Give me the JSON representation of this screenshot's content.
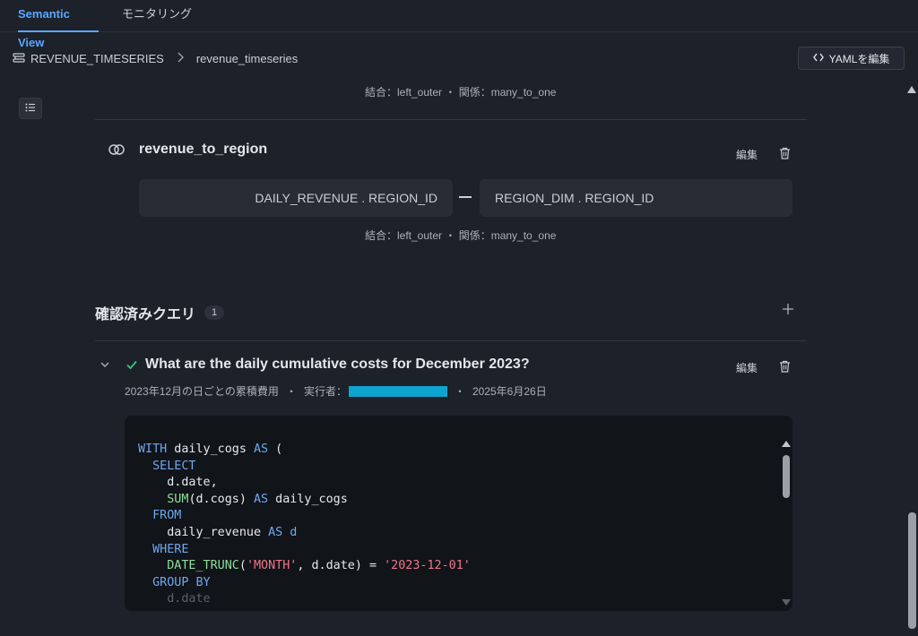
{
  "tabs": [
    {
      "label": "Semantic View",
      "active": true
    },
    {
      "label": "モニタリング",
      "active": false
    }
  ],
  "breadcrumb": {
    "model_name": "REVENUE_TIMESERIES",
    "separator_icon": "chevron-right-icon",
    "view_name": "revenue_timeseries"
  },
  "yaml_button": {
    "icon": "code-brackets-icon",
    "label": "YAMLを編集"
  },
  "outline_button": {
    "icon": "list-icon"
  },
  "relationship_prev": {
    "meta": "結合：left_outer ・ 関係：many_to_one"
  },
  "relationship": {
    "icon": "link-rings-icon",
    "name": "revenue_to_region",
    "edit_label": "編集",
    "left_field": "DAILY_REVENUE . REGION_ID",
    "right_field": "REGION_DIM . REGION_ID",
    "meta": "結合：left_outer ・ 関係：many_to_one"
  },
  "verified_queries": {
    "title": "確認済みクエリ",
    "count": "1",
    "add_icon": "plus-icon",
    "items": [
      {
        "status_icon": "check-icon",
        "question": "What are the daily cumulative costs for December 2023?",
        "description": "2023年12月の日ごとの累積費用",
        "executor_label": "実行者：",
        "date": "2025年6月26日",
        "edit_label": "編集"
      }
    ]
  },
  "colors": {
    "background": "#1d2129",
    "accent": "#5aa7ff",
    "keyword": "#6fa8f0",
    "function": "#8ede9a",
    "string": "#f0758a",
    "check": "#3ec47a",
    "redaction": "#0fa3d0"
  },
  "sql": {
    "l1_kw1": "WITH",
    "l1_name": " daily_cogs ",
    "l1_kw2": "AS",
    "l1_paren": " (",
    "l2_kw": "SELECT",
    "l3_text": "d.date,",
    "l4_fn": "SUM",
    "l4_arg": "(d.cogs) ",
    "l4_kw": "AS",
    "l4_alias": " daily_cogs",
    "l5_kw": "FROM",
    "l6_table": "daily_revenue ",
    "l6_kw": "AS",
    "l6_alias": " d",
    "l7_kw": "WHERE",
    "l8_fn": "DATE_TRUNC",
    "l8_open": "(",
    "l8_str1": "'MONTH'",
    "l8_mid": ", d.date) = ",
    "l8_str2": "'2023-12-01'",
    "l9_kw": "GROUP BY",
    "l10_text": "d.date"
  }
}
